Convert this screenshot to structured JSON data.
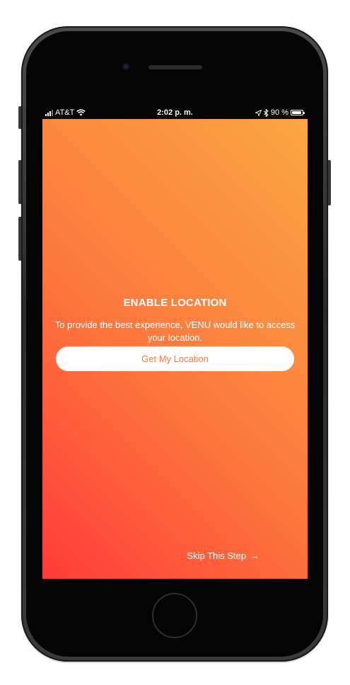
{
  "status_bar": {
    "carrier": "AT&T",
    "time": "2:02 p. m.",
    "battery_text": "90 %",
    "battery_level": 0.9,
    "icons": [
      "signal-icon",
      "wifi-icon",
      "location-arrow-icon",
      "bluetooth-icon",
      "battery-icon"
    ]
  },
  "screen": {
    "title": "ENABLE LOCATION",
    "description": "To provide the best experience, VENU would like to access your location.",
    "primary_button_label": "Get My Location",
    "skip_label": "Skip This Step",
    "skip_arrow": "→"
  },
  "colors": {
    "gradient_top_right": "#fba643",
    "gradient_bottom_left": "#ff3b38",
    "button_text": "#fd7a3d"
  }
}
